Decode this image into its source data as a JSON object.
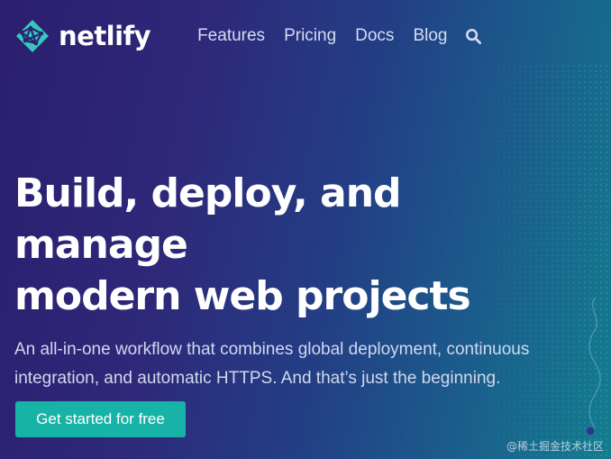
{
  "brand": {
    "name": "netlify",
    "icon": "netlify-logo-icon"
  },
  "nav": {
    "items": [
      {
        "label": "Features"
      },
      {
        "label": "Pricing"
      },
      {
        "label": "Docs"
      },
      {
        "label": "Blog"
      }
    ],
    "search_icon": "search-icon"
  },
  "hero": {
    "headline_line1": "Build, deploy, and manage",
    "headline_line2": "modern web projects",
    "subtext": "An all-in-one workflow that combines global deployment, continuous integration, and automatic HTTPS. And that’s just the beginning.",
    "cta_label": "Get started for free"
  },
  "watermark": "@稀土掘金技术社区",
  "colors": {
    "background_start": "#2b1e6e",
    "background_end": "#137d8e",
    "accent": "#17b3a6",
    "logo_teal": "#35c8bb"
  }
}
